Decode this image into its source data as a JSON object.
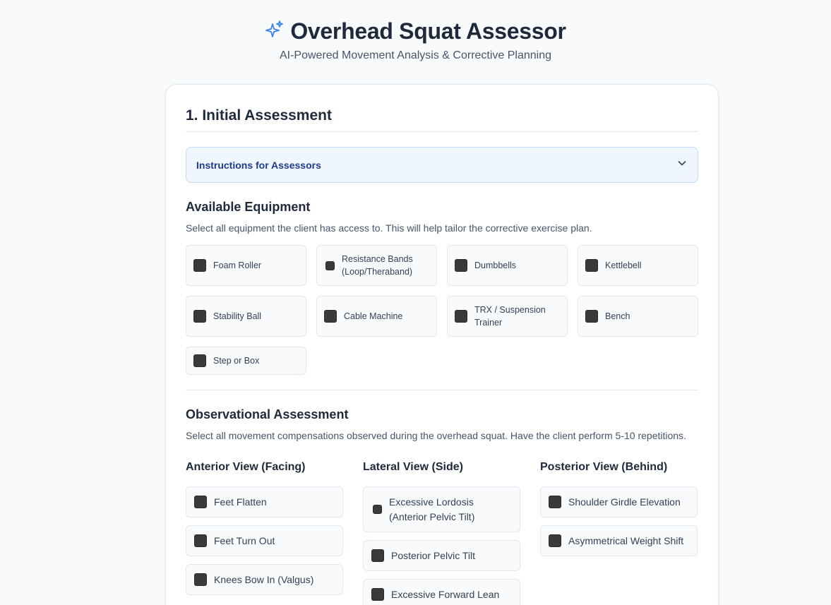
{
  "header": {
    "icon": "sparkles-icon",
    "title": "Overhead Squat Assessor",
    "subtitle": "AI-Powered Movement Analysis & Corrective Planning"
  },
  "assessment": {
    "section_title": "1. Initial Assessment",
    "instructions_label": "Instructions for Assessors",
    "equipment": {
      "title": "Available Equipment",
      "help": "Select all equipment the client has access to. This will help tailor the corrective exercise plan.",
      "items": [
        {
          "label": "Foam Roller",
          "checked": false
        },
        {
          "label": "Resistance Bands (Loop/Theraband)",
          "checked": false
        },
        {
          "label": "Dumbbells",
          "checked": false
        },
        {
          "label": "Kettlebell",
          "checked": false
        },
        {
          "label": "Stability Ball",
          "checked": false
        },
        {
          "label": "Cable Machine",
          "checked": false
        },
        {
          "label": "TRX / Suspension Trainer",
          "checked": false
        },
        {
          "label": "Bench",
          "checked": false
        },
        {
          "label": "Step or Box",
          "checked": false
        }
      ]
    },
    "observational": {
      "title": "Observational Assessment",
      "help": "Select all movement compensations observed during the overhead squat. Have the client perform 5-10 repetitions.",
      "anterior": {
        "title": "Anterior View (Facing)",
        "items": [
          "Feet Flatten",
          "Feet Turn Out",
          "Knees Bow In (Valgus)"
        ]
      },
      "lateral": {
        "title": "Lateral View (Side)",
        "items": [
          "Excessive Lordosis (Anterior Pelvic Tilt)",
          "Posterior Pelvic Tilt",
          "Excessive Forward Lean"
        ]
      },
      "posterior": {
        "title": "Posterior View (Behind)",
        "items": [
          "Shoulder Girdle Elevation",
          "Asymmetrical Weight Shift"
        ]
      }
    }
  },
  "colors": {
    "accent": "#3b82f6",
    "instructions_bg": "#eff6ff",
    "instructions_text": "#1e3a8a"
  }
}
